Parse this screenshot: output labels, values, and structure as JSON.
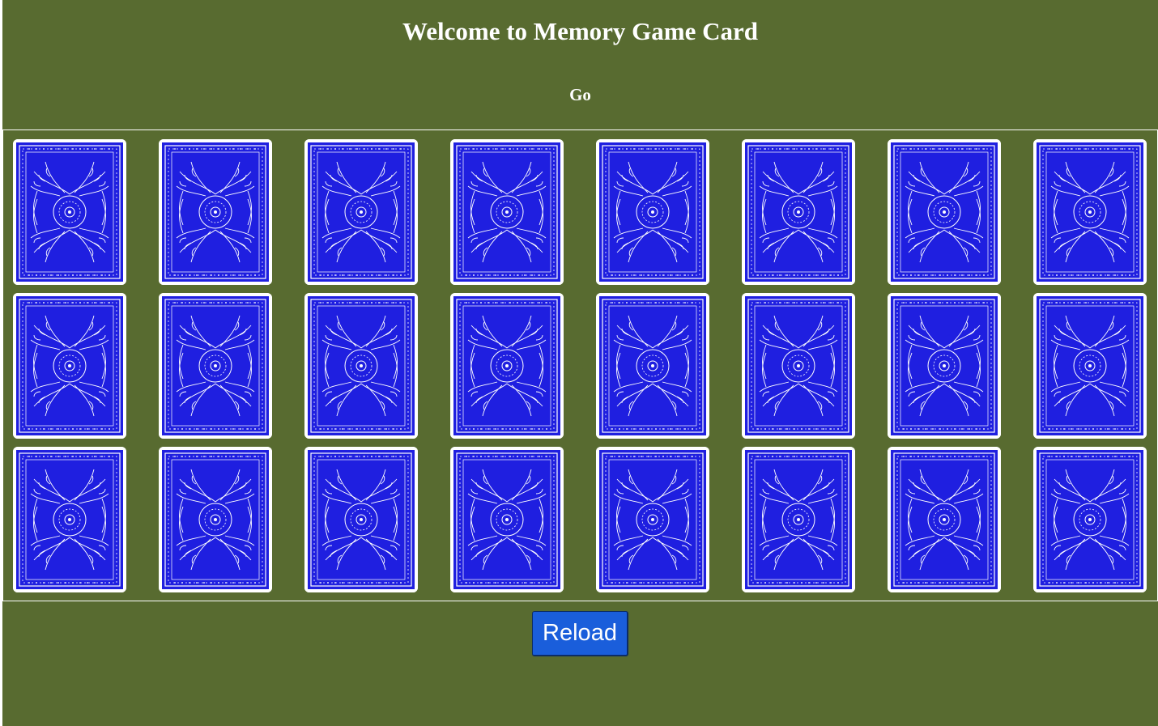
{
  "header": {
    "title": "Welcome to Memory Game Card",
    "go_label": "Go"
  },
  "board": {
    "rows": 3,
    "columns": 8,
    "card_state": "face-down",
    "card_back_color": "#1f1fe0"
  },
  "footer": {
    "reload_label": "Reload"
  },
  "colors": {
    "background": "#586b30",
    "reload_button": "#1a5edb"
  }
}
